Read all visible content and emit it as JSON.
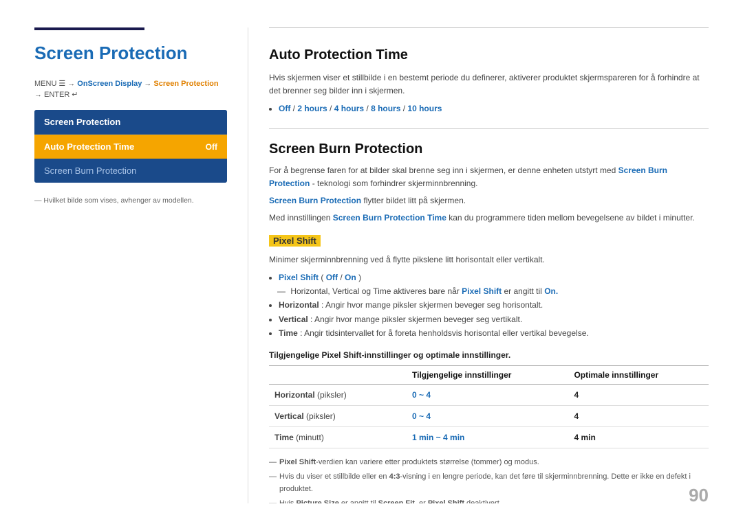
{
  "left": {
    "top_bar": "",
    "page_title": "Screen Protection",
    "menu_path": {
      "prefix": "MENU",
      "menu_icon": "☰",
      "arrow1": "→",
      "item1": "OnScreen Display",
      "arrow2": "→",
      "item2": "Screen Protection",
      "arrow3": "→",
      "item3": "ENTER",
      "enter_icon": "↵"
    },
    "menu_box_header": "Screen Protection",
    "menu_items": [
      {
        "label": "Auto Protection Time",
        "value": "Off",
        "active": true
      },
      {
        "label": "Screen Burn Protection",
        "value": "",
        "active": false
      }
    ],
    "footnote": "― Hvilket bilde som vises, avhenger av modellen."
  },
  "right": {
    "section1": {
      "title": "Auto Protection Time",
      "desc": "Hvis skjermen viser et stillbilde i en bestemt periode du definerer, aktiverer produktet skjermspareren for å forhindre at det brenner seg bilder inn i skjermen.",
      "options_label": "Off / 2 hours / 4 hours / 8 hours / 10 hours"
    },
    "section2": {
      "title": "Screen Burn Protection",
      "desc1": "For å begrense faren for at bilder skal brenne seg inn i skjermen, er denne enheten utstyrt med",
      "desc1_link": "Screen Burn Protection",
      "desc1_suffix": "teknologi som forhindrer skjerminnbrenning.",
      "desc2_link": "Screen Burn Protection",
      "desc2_suffix": "flytter bildet litt på skjermen.",
      "desc3_prefix": "Med innstillingen",
      "desc3_link": "Screen Burn Protection Time",
      "desc3_suffix": "kan du programmere tiden mellom bevegelsene av bildet i minutter.",
      "pixel_shift": {
        "label": "Pixel Shift",
        "desc": "Minimer skjerminnbrenning ved å flytte pikslene litt horisontalt eller vertikalt.",
        "bullets": [
          {
            "text_prefix": "",
            "link": "Pixel Shift",
            "text_mid": " (",
            "opt_off": "Off",
            "slash": " / ",
            "opt_on": "On",
            "text_suffix": ")"
          },
          {
            "plain": "― Horizontal, Vertical og Time aktiveres bare når",
            "link": "Pixel Shift",
            "suffix": "er angitt til On."
          },
          {
            "bold": "Horizontal",
            "suffix": ": Angir hvor mange piksler skjermen beveger seg horisontalt."
          },
          {
            "bold": "Vertical",
            "suffix": ": Angir hvor mange piksler skjermen beveger seg vertikalt."
          },
          {
            "bold": "Time",
            "suffix": ": Angir tidsintervallet for å foreta henholdsvis horisontal eller vertikal bevegelse."
          }
        ]
      },
      "table": {
        "caption": "Tilgjengelige Pixel Shift-innstillinger og optimale innstillinger.",
        "headers": [
          "",
          "Tilgjengelige innstillinger",
          "Optimale innstillinger"
        ],
        "rows": [
          {
            "label": "Horizontal",
            "sublabel": "(piksler)",
            "available": "0 ~ 4",
            "optimal": "4"
          },
          {
            "label": "Vertical",
            "sublabel": "(piksler)",
            "available": "0 ~ 4",
            "optimal": "4"
          },
          {
            "label": "Time",
            "sublabel": "(minutt)",
            "available": "1 min ~ 4 min",
            "optimal": "4 min"
          }
        ]
      },
      "footnotes": [
        "― Pixel Shift-verdien kan variere etter produktets størrelse (tommer) og modus.",
        "― Hvis du viser et stillbilde eller en 4:3-visning i en lengre periode, kan det føre til skjerminnbrenning. Dette er ikke en defekt i produktet.",
        "― Hvis Picture Size er angitt til Screen Fit, er Pixel Shift deaktivert."
      ]
    }
  },
  "page_number": "90"
}
